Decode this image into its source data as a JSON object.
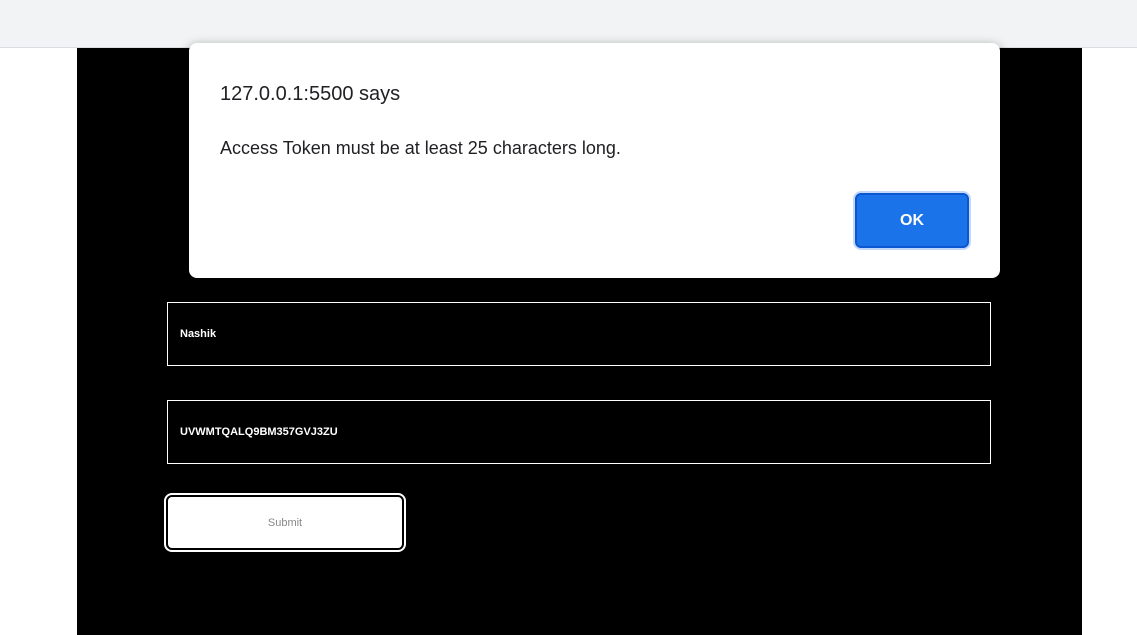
{
  "form": {
    "location_value": "Nashik",
    "token_value": "UVWMTQALQ9BM357GVJ3ZU",
    "submit_label": "Submit"
  },
  "alert": {
    "origin": "127.0.0.1:5500 says",
    "message": "Access Token must be at least 25 characters long.",
    "ok_label": "OK"
  },
  "colors": {
    "page_background": "#ffffff",
    "panel_background": "#000000",
    "ok_button": "#1a73e8"
  }
}
